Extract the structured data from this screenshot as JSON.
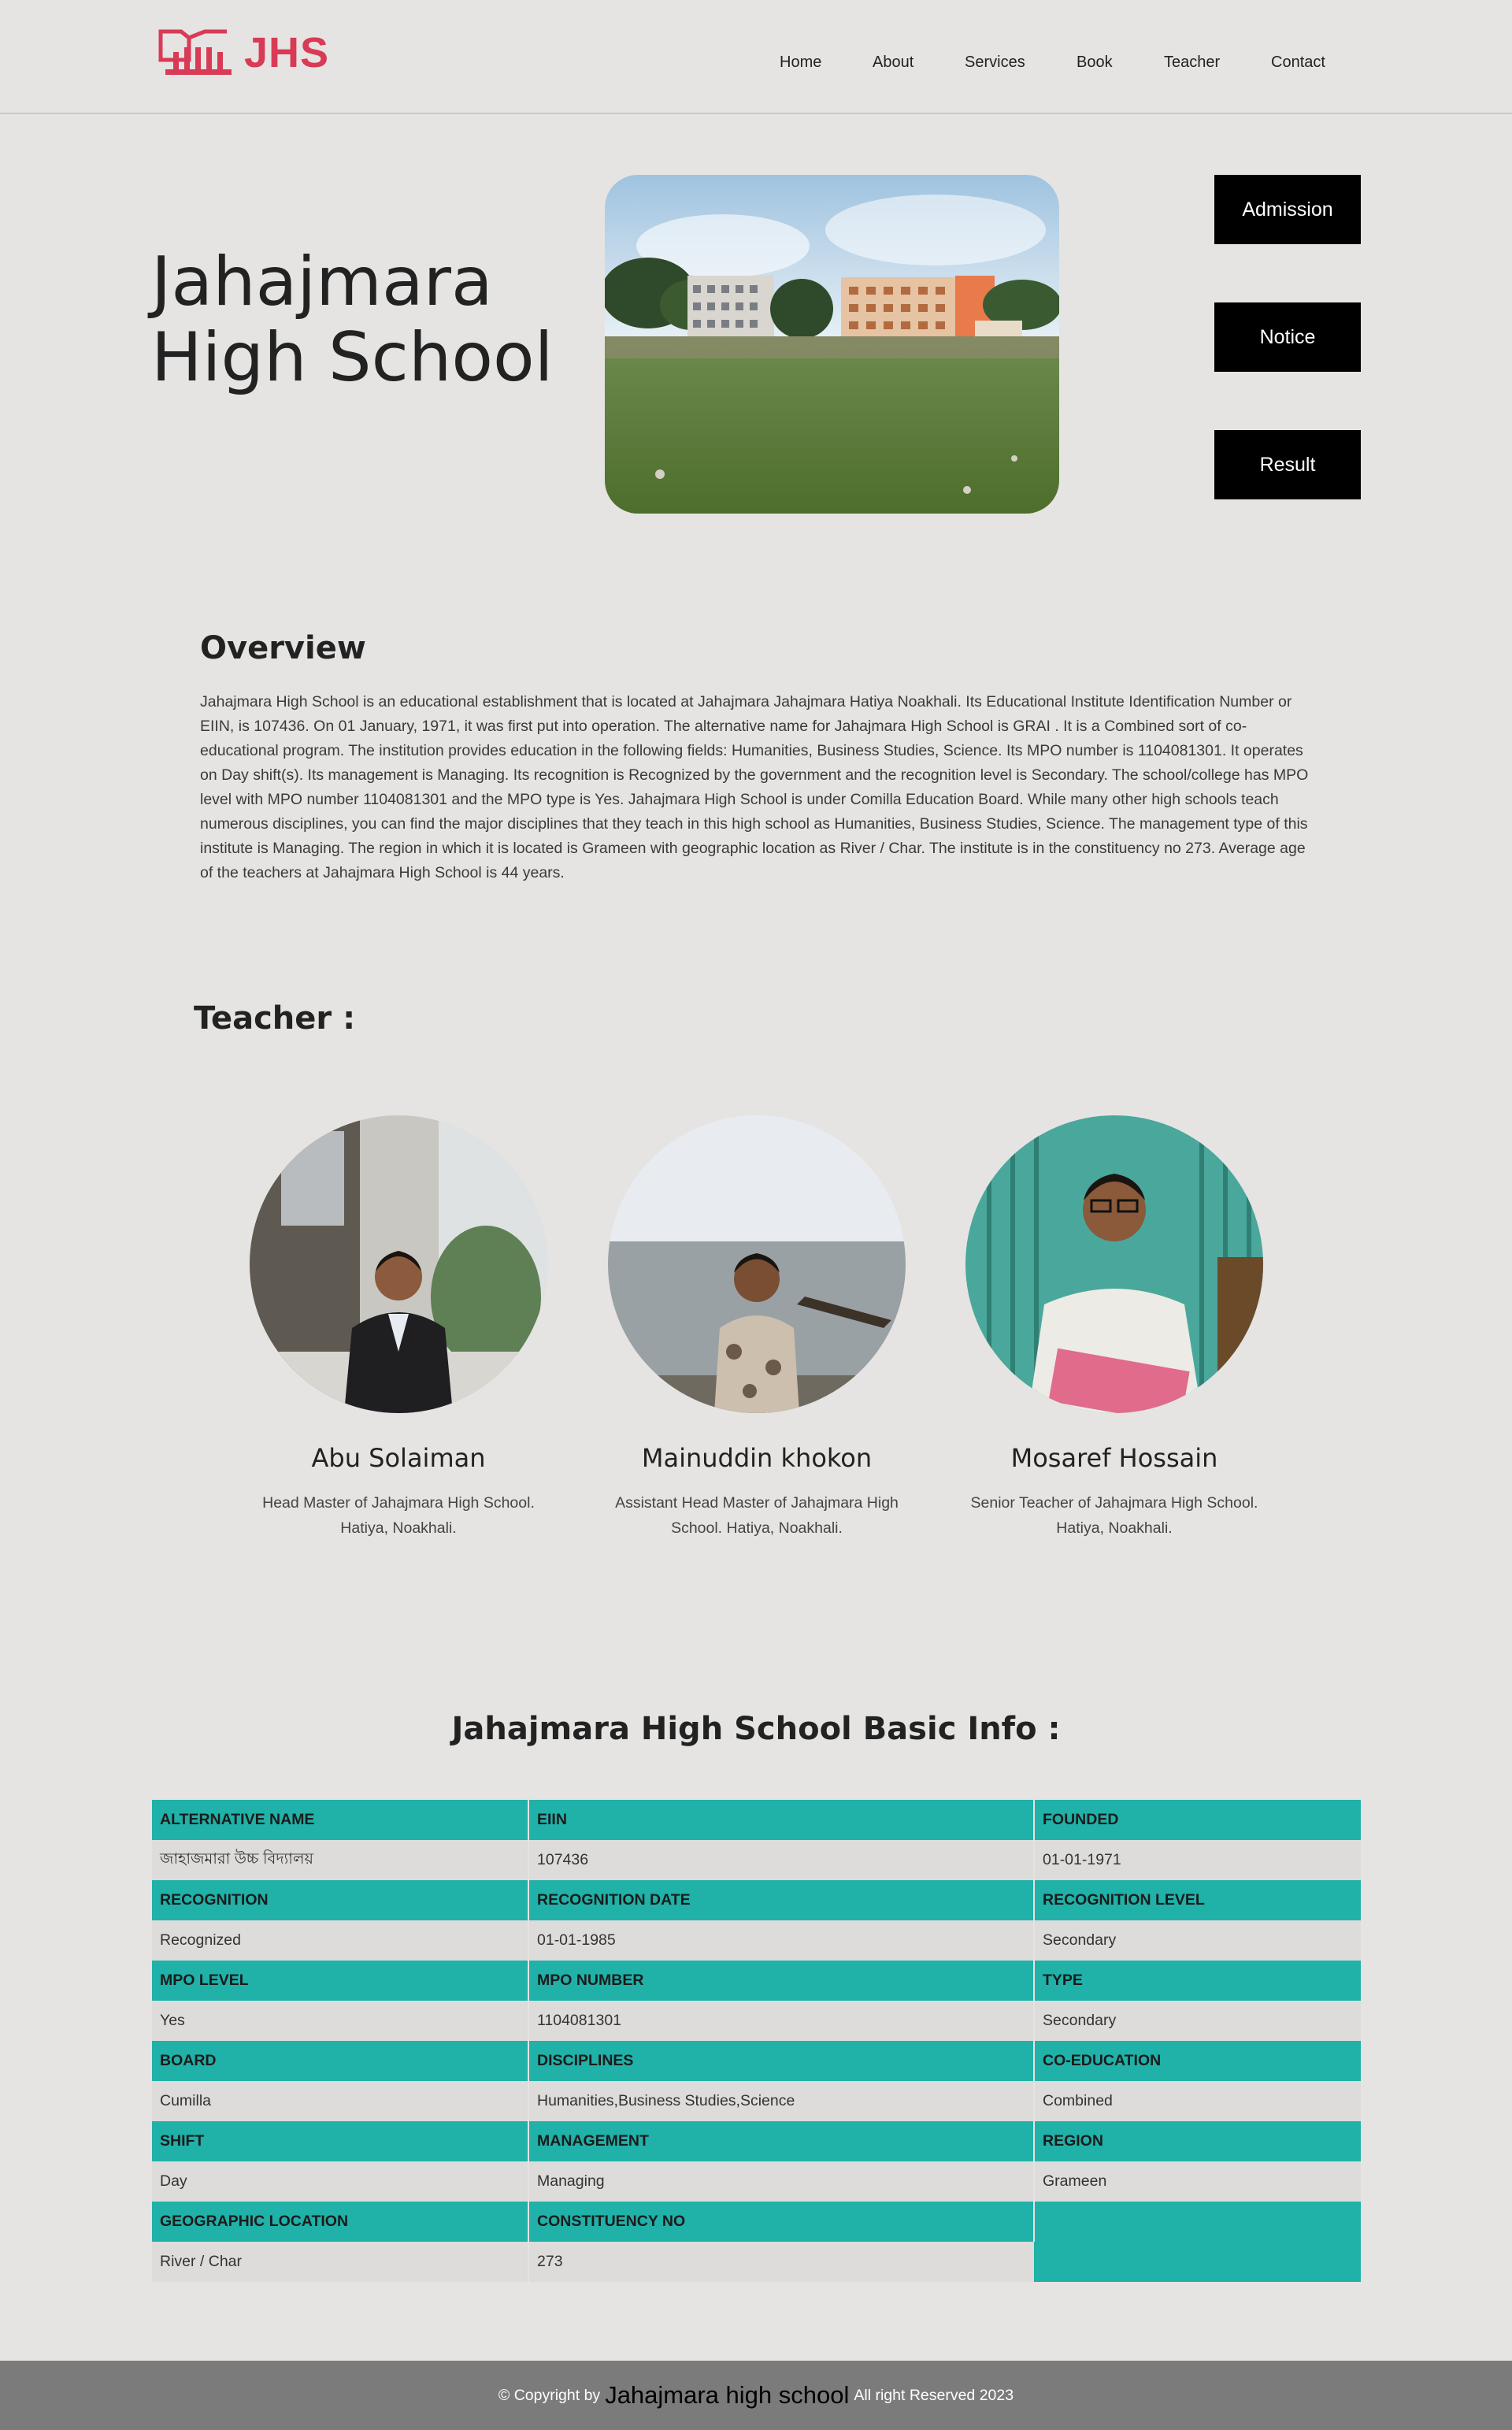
{
  "header": {
    "logo_text": "JHS",
    "nav": [
      "Home",
      "About",
      "Services",
      "Book",
      "Teacher",
      "Contact"
    ]
  },
  "hero": {
    "title_line1": "Jahajmara",
    "title_line2": "High School",
    "buttons": [
      "Admission",
      "Notice",
      "Result"
    ]
  },
  "overview": {
    "title": "Overview",
    "text": "Jahajmara High School is an educational establishment that is located at Jahajmara Jahajmara Hatiya Noakhali. Its Educational Institute Identification Number or EIIN, is 107436. On 01 January, 1971, it was first put into operation. The alternative name for Jahajmara High School is GRAI . It is a Combined sort of co-educational program. The institution provides education in the following fields: Humanities, Business Studies, Science. Its MPO number is 1104081301. It operates on Day shift(s). Its management is Managing. Its recognition is Recognized by the government and the recognition level is Secondary. The school/college has MPO level with MPO number 1104081301 and the MPO type is Yes. Jahajmara High School is under Comilla Education Board. While many other high schools teach numerous disciplines, you can find the major disciplines that they teach in this high school as Humanities, Business Studies, Science. The management type of this institute is Managing. The region in which it is located is Grameen with geographic location as River / Char. The institute is in the constituency no 273. Average age of the teachers at Jahajmara High School is 44 years."
  },
  "teachers": {
    "heading": "Teacher :",
    "list": [
      {
        "name": "Abu Solaiman",
        "role": "Head Master of Jahajmara High School. Hatiya, Noakhali."
      },
      {
        "name": "Mainuddin khokon",
        "role": "Assistant Head Master of Jahajmara High School. Hatiya, Noakhali."
      },
      {
        "name": "Mosaref Hossain",
        "role": "Senior Teacher of Jahajmara High School. Hatiya, Noakhali."
      }
    ]
  },
  "info": {
    "title": "Jahajmara High School Basic Info :",
    "rows": [
      {
        "h": [
          "ALTERNATIVE NAME",
          "EIIN",
          "FOUNDED"
        ],
        "v": [
          "জাহাজমারা উচ্চ বিদ্যালয়",
          "107436",
          "01-01-1971"
        ]
      },
      {
        "h": [
          "RECOGNITION",
          "RECOGNITION DATE",
          "RECOGNITION LEVEL"
        ],
        "v": [
          "Recognized",
          "01-01-1985",
          "Secondary"
        ]
      },
      {
        "h": [
          "MPO LEVEL",
          "MPO NUMBER",
          "TYPE"
        ],
        "v": [
          "Yes",
          "1104081301",
          "Secondary"
        ]
      },
      {
        "h": [
          "BOARD",
          "DISCIPLINES",
          "CO-EDUCATION"
        ],
        "v": [
          "Cumilla",
          "Humanities,Business Studies,Science",
          "Combined"
        ]
      },
      {
        "h": [
          "SHIFT",
          "MANAGEMENT",
          "REGION"
        ],
        "v": [
          "Day",
          "Managing",
          "Grameen"
        ]
      },
      {
        "h": [
          "GEOGRAPHIC LOCATION",
          "CONSTITUENCY NO"
        ],
        "v": [
          "River / Char",
          "273"
        ]
      }
    ]
  },
  "footer": {
    "prefix": "© Copyright by",
    "brand": "Jahajmara high school",
    "suffix": "All right Reserved 2023"
  },
  "colors": {
    "accent": "#20b1a8",
    "logo": "#d93a55",
    "footer": "#7b7b7b",
    "background": "#e5e4e2"
  }
}
